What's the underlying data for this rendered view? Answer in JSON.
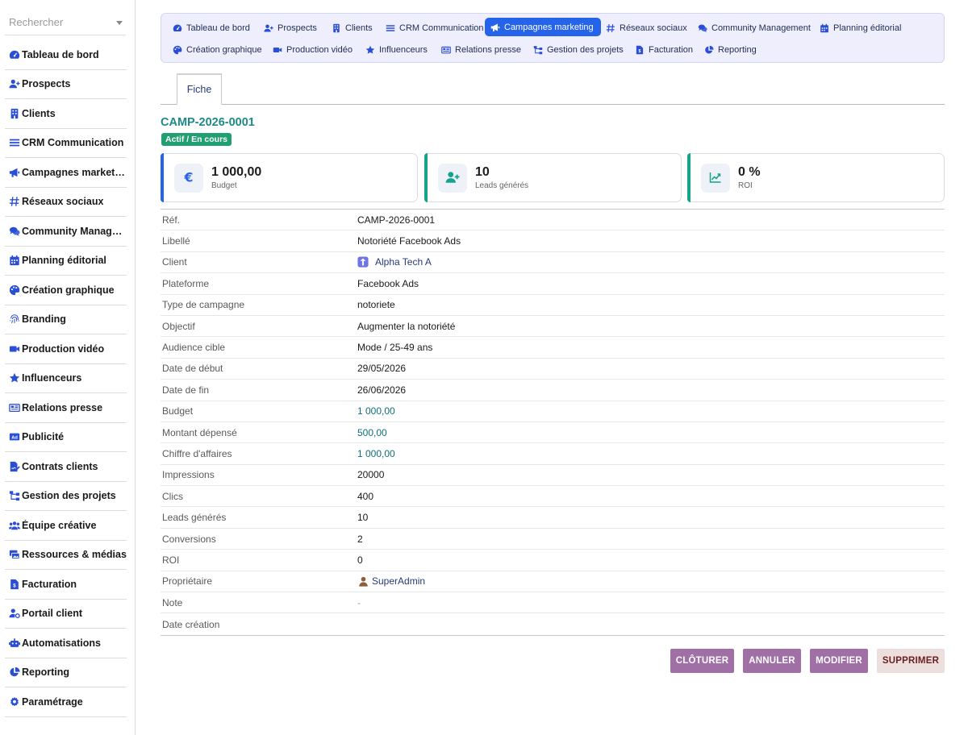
{
  "search": {
    "placeholder": "Rechercher"
  },
  "sidebar": {
    "items": [
      {
        "label": "Tableau de bord",
        "icon": "gauge-icon"
      },
      {
        "label": "Prospects",
        "icon": "user-plus-icon"
      },
      {
        "label": "Clients",
        "icon": "building-icon"
      },
      {
        "label": "CRM Communication",
        "icon": "bars-icon"
      },
      {
        "label": "Campagnes marketing",
        "icon": "megaphone-icon"
      },
      {
        "label": "Réseaux sociaux",
        "icon": "hashtag-icon"
      },
      {
        "label": "Community Management",
        "icon": "comments-icon"
      },
      {
        "label": "Planning éditorial",
        "icon": "calendar-icon"
      },
      {
        "label": "Création graphique",
        "icon": "palette-icon"
      },
      {
        "label": "Branding",
        "icon": "fingerprint-icon"
      },
      {
        "label": "Production vidéo",
        "icon": "video-icon"
      },
      {
        "label": "Influenceurs",
        "icon": "star-icon"
      },
      {
        "label": "Relations presse",
        "icon": "newspaper-icon"
      },
      {
        "label": "Publicité",
        "icon": "ad-icon"
      },
      {
        "label": "Contrats clients",
        "icon": "file-signature-icon"
      },
      {
        "label": "Gestion des projets",
        "icon": "sitemap-icon"
      },
      {
        "label": "Équipe créative",
        "icon": "users-icon"
      },
      {
        "label": "Ressources & médias",
        "icon": "photo-video-icon"
      },
      {
        "label": "Facturation",
        "icon": "invoice-icon"
      },
      {
        "label": "Portail client",
        "icon": "user-cog-icon"
      },
      {
        "label": "Automatisations",
        "icon": "robot-icon"
      },
      {
        "label": "Reporting",
        "icon": "chart-pie-icon"
      },
      {
        "label": "Paramétrage",
        "icon": "cog-icon"
      }
    ]
  },
  "topnav": {
    "items": [
      {
        "label": "Tableau de bord",
        "icon": "gauge-icon",
        "active": false
      },
      {
        "label": "Prospects",
        "icon": "user-plus-icon",
        "active": false
      },
      {
        "label": "Clients",
        "icon": "building-icon",
        "active": false
      },
      {
        "label": "CRM Communication",
        "icon": "bars-icon",
        "active": false
      },
      {
        "label": "Campagnes marketing",
        "icon": "megaphone-icon",
        "active": true
      },
      {
        "label": "Réseaux sociaux",
        "icon": "hashtag-icon",
        "active": false
      },
      {
        "label": "Community Management",
        "icon": "comments-icon",
        "active": false
      },
      {
        "label": "Planning éditorial",
        "icon": "calendar-icon",
        "active": false
      },
      {
        "label": "Création graphique",
        "icon": "palette-icon",
        "active": false
      },
      {
        "label": "Production vidéo",
        "icon": "video-icon",
        "active": false
      },
      {
        "label": "Influenceurs",
        "icon": "star-icon",
        "active": false
      },
      {
        "label": "Relations presse",
        "icon": "newspaper-icon",
        "active": false
      },
      {
        "label": "Gestion des projets",
        "icon": "sitemap-icon",
        "active": false
      },
      {
        "label": "Facturation",
        "icon": "invoice-icon",
        "active": false
      },
      {
        "label": "Reporting",
        "icon": "chart-pie-icon",
        "active": false
      }
    ]
  },
  "tabs": {
    "fiche": "Fiche"
  },
  "record": {
    "ref": "CAMP-2026-0001",
    "status": "Actif / En cours"
  },
  "kpis": [
    {
      "value": "1 000,00",
      "label": "Budget",
      "icon": "euro-icon",
      "accent": "#2563eb"
    },
    {
      "value": "10",
      "label": "Leads générés",
      "icon": "user-plus-icon",
      "accent": "#14a38b"
    },
    {
      "value": "0 %",
      "label": "ROI",
      "icon": "chart-line-icon",
      "accent": "#14a38b"
    }
  ],
  "details": [
    {
      "key": "Réf.",
      "value": "CAMP-2026-0001",
      "type": "text"
    },
    {
      "key": "Libellé",
      "value": "Notoriété Facebook Ads",
      "type": "text"
    },
    {
      "key": "Client",
      "value": "Alpha Tech A",
      "type": "client"
    },
    {
      "key": "Plateforme",
      "value": "Facebook Ads",
      "type": "text"
    },
    {
      "key": "Type de campagne",
      "value": "notoriete",
      "type": "text"
    },
    {
      "key": "Objectif",
      "value": "Augmenter la notoriété",
      "type": "text"
    },
    {
      "key": "Audience cible",
      "value": "Mode / 25-49 ans",
      "type": "text"
    },
    {
      "key": "Date de début",
      "value": "29/05/2026",
      "type": "text"
    },
    {
      "key": "Date de fin",
      "value": "26/06/2026",
      "type": "text"
    },
    {
      "key": "Budget",
      "value": "1 000,00",
      "type": "money"
    },
    {
      "key": "Montant dépensé",
      "value": "500,00",
      "type": "money"
    },
    {
      "key": "Chiffre d'affaires",
      "value": "1 000,00",
      "type": "money"
    },
    {
      "key": "Impressions",
      "value": "20000",
      "type": "text"
    },
    {
      "key": "Clics",
      "value": "400",
      "type": "text"
    },
    {
      "key": "Leads générés",
      "value": "10",
      "type": "text"
    },
    {
      "key": "Conversions",
      "value": "2",
      "type": "text"
    },
    {
      "key": "ROI",
      "value": "0",
      "type": "text"
    },
    {
      "key": "Propriétaire",
      "value": "SuperAdmin",
      "type": "user"
    },
    {
      "key": "Note",
      "value": "-",
      "type": "empty"
    },
    {
      "key": "Date création",
      "value": "",
      "type": "text"
    }
  ],
  "actions": {
    "close": "CLÔTURER",
    "cancel": "ANNULER",
    "edit": "MODIFIER",
    "delete": "SUPPRIMER"
  },
  "colors": {
    "accent": "#2563eb",
    "teal": "#1d8a87",
    "status_green": "#20a070",
    "action_purple": "#9f6fa6",
    "icon_blue": "#2a4fd6"
  }
}
